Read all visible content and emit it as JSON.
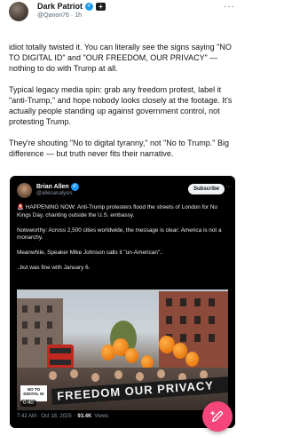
{
  "post": {
    "display_name": "Dark Patriot",
    "handle": "@Qanon76",
    "separator": "·",
    "time": "1h",
    "paragraphs": [
      "idiot totally twisted it. You can literally see the signs saying \"NO TO DIGITAL ID\" and \"OUR FREEDOM, OUR PRIVACY\" — nothing to do with Trump at all.",
      "Typical legacy media spin: grab any freedom protest, label it \"anti-Trump,\" and hope nobody looks closely at the footage. It's actually people standing up against government control, not protesting Trump.",
      "They're shouting \"No to digital tyranny,\" not \"No to Trump.\" Big difference — but truth never fits their narrative."
    ]
  },
  "quote": {
    "display_name": "Brian Allen",
    "handle": "@allenanalysis",
    "subscribe_label": "Subscribe",
    "paragraphs": [
      "🚨 HAPPENING NOW: Anti-Trump protesters flood the streets of London for No Kings Day, chanting outside the U.S. embassy.",
      "Noteworthy: Across 2,500 cities worldwide, the message is clear: America is not a monarchy.",
      "Meanwhile, Speaker Mike Johnson calls it \"un-American\"..",
      "..but was fine with January 6."
    ],
    "video": {
      "duration": "0:40",
      "banner_text": "FREEDOM OUR PRIVACY",
      "sign_text": "NO TO DIGITAL ID"
    },
    "timestamp": "7:42 AM · Oct 18, 2025 ·",
    "views_count": "93.4K",
    "views_label": "Views"
  },
  "icons": {
    "verified": "verified-check-icon",
    "more": "more-dots-icon",
    "compose": "compose-feather-icon"
  },
  "colors": {
    "accent_blue": "#1d9bf0",
    "compose_fab": "#f5467c",
    "quote_bg": "#000000"
  }
}
